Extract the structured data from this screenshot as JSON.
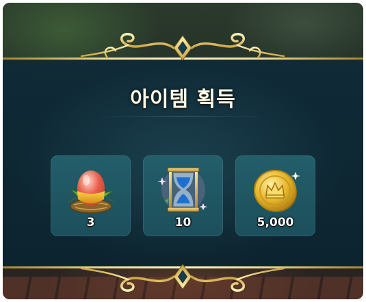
{
  "dialog": {
    "title": "아이템 획득"
  },
  "items": [
    {
      "name": "egg-icon",
      "quantity": "3"
    },
    {
      "name": "hourglass-icon",
      "quantity": "10"
    },
    {
      "name": "gold-coin-icon",
      "quantity": "5,000"
    }
  ],
  "colors": {
    "panel": "#0e2a38",
    "slot": "#235e6a",
    "gold": "#f5e29a"
  }
}
